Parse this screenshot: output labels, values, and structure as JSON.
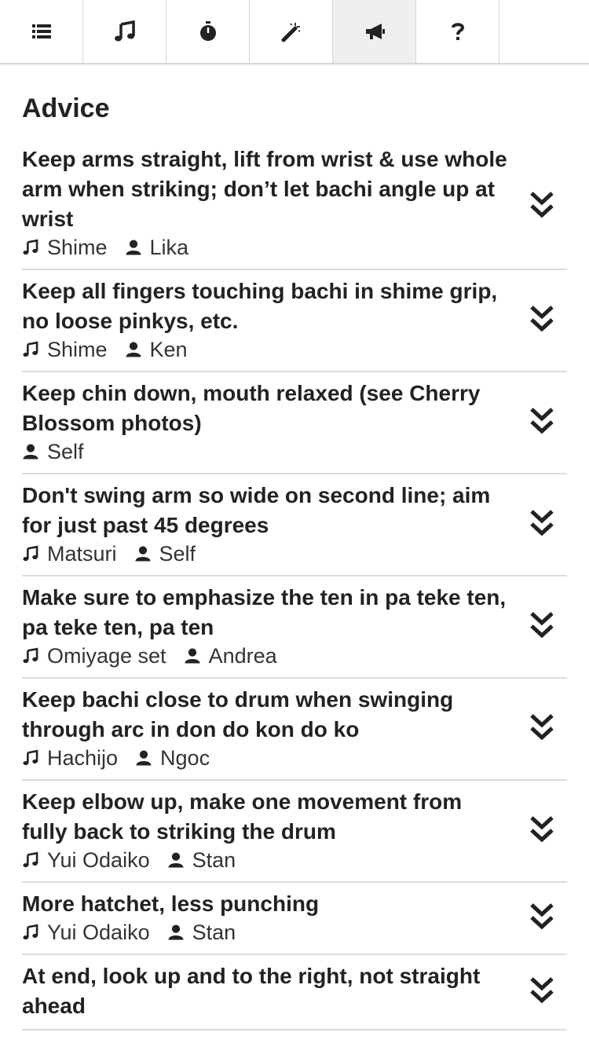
{
  "tabs": [
    {
      "icon": "list-icon"
    },
    {
      "icon": "music-note-icon"
    },
    {
      "icon": "stopwatch-icon"
    },
    {
      "icon": "magic-wand-icon"
    },
    {
      "icon": "megaphone-icon",
      "active": true
    },
    {
      "icon": "question-mark-icon",
      "label": "?"
    }
  ],
  "page": {
    "title": "Advice"
  },
  "advice": [
    {
      "text": "Keep arms straight, lift from wrist & use whole arm when striking; don’t let bachi angle up at wrist",
      "song": "Shime",
      "person": "Lika"
    },
    {
      "text": "Keep all fingers touching bachi in shime grip, no loose pinkys, etc.",
      "song": "Shime",
      "person": "Ken"
    },
    {
      "text": "Keep chin down, mouth relaxed (see Cherry Blossom photos)",
      "song": null,
      "person": "Self"
    },
    {
      "text": "Don't swing arm so wide on second line; aim for just past 45 degrees",
      "song": "Matsuri",
      "person": "Self"
    },
    {
      "text": "Make sure to emphasize the ten in pa teke ten, pa teke ten, pa ten",
      "song": "Omiyage set",
      "person": "Andrea"
    },
    {
      "text": "Keep bachi close to drum when swinging through arc in don do kon do ko",
      "song": "Hachijo",
      "person": "Ngoc"
    },
    {
      "text": "Keep elbow up, make one movement from fully back to striking the drum",
      "song": "Yui Odaiko",
      "person": "Stan"
    },
    {
      "text": "More hatchet, less punching",
      "song": "Yui Odaiko",
      "person": "Stan"
    },
    {
      "text": "At end, look up and to the right, not straight ahead",
      "song": null,
      "person": null
    }
  ],
  "colors": {
    "active_tab_bg": "#efefef",
    "divider": "#dcdcdc",
    "text": "#222222"
  }
}
